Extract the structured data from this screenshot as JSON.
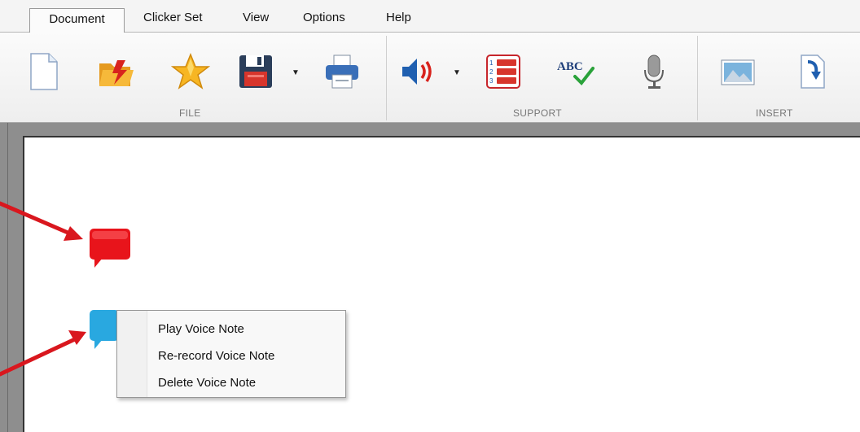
{
  "menu": {
    "items": [
      "Document",
      "Clicker Set",
      "View",
      "Options",
      "Help"
    ],
    "active_index": 0
  },
  "ribbon": {
    "groups": {
      "file": "FILE",
      "support": "SUPPORT",
      "insert": "INSERT"
    }
  },
  "spellcheck": {
    "label": "ABC"
  },
  "context_menu": {
    "items": [
      "Play Voice Note",
      "Re-record Voice Note",
      "Delete Voice Note"
    ]
  },
  "colors": {
    "voice_note_red": "#e8141b",
    "voice_note_blue": "#29a8e0",
    "arrow_red": "#d9171e",
    "save_red": "#d7352c",
    "accent_blue": "#1f5fb0"
  },
  "icons": {
    "file": [
      "new-document-icon",
      "open-folder-icon",
      "favorite-star-icon",
      "save-disk-icon",
      "print-icon"
    ],
    "support": [
      "speaker-icon",
      "numbered-list-icon",
      "spellcheck-icon",
      "microphone-icon"
    ],
    "insert": [
      "picture-icon",
      "import-document-icon"
    ]
  }
}
